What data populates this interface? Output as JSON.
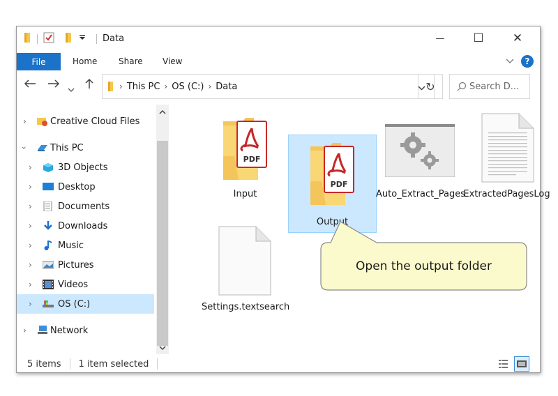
{
  "window": {
    "title": "Data",
    "controls": {
      "minimize": "—",
      "maximize": "☐",
      "close": "✕"
    }
  },
  "ribbon": {
    "file": "File",
    "tabs": [
      "Home",
      "Share",
      "View"
    ],
    "help": "?"
  },
  "address": {
    "segments": [
      "This PC",
      "OS (C:)",
      "Data"
    ],
    "search_placeholder": "Search D..."
  },
  "nav": {
    "items": [
      {
        "label": "Creative Cloud Files",
        "icon": "creative-cloud-icon"
      },
      {
        "label": "This PC",
        "icon": "pc-icon"
      },
      {
        "label": "3D Objects",
        "icon": "3d-objects-icon"
      },
      {
        "label": "Desktop",
        "icon": "desktop-icon"
      },
      {
        "label": "Documents",
        "icon": "documents-icon"
      },
      {
        "label": "Downloads",
        "icon": "downloads-icon"
      },
      {
        "label": "Music",
        "icon": "music-icon"
      },
      {
        "label": "Pictures",
        "icon": "pictures-icon"
      },
      {
        "label": "Videos",
        "icon": "videos-icon"
      },
      {
        "label": "OS (C:)",
        "icon": "drive-icon"
      },
      {
        "label": "Network",
        "icon": "network-icon"
      }
    ]
  },
  "files": {
    "items": [
      {
        "name": "Input",
        "icon": "pdf-folder-icon"
      },
      {
        "name": "Output",
        "icon": "pdf-folder-icon",
        "selected": true
      },
      {
        "name": "Auto_Extract_Pages",
        "icon": "app-gear-icon"
      },
      {
        "name": "ExtractedPagesLog",
        "icon": "text-document-icon"
      },
      {
        "name": "Settings.textsearch",
        "icon": "blank-file-icon"
      }
    ],
    "pdf_badge": "PDF"
  },
  "status": {
    "count": "5 items",
    "selection": "1 item selected"
  },
  "callout": {
    "text": "Open the output folder"
  },
  "colors": {
    "accent": "#1a73c8",
    "selection": "#cce8ff",
    "callout_fill": "#fafacc"
  }
}
